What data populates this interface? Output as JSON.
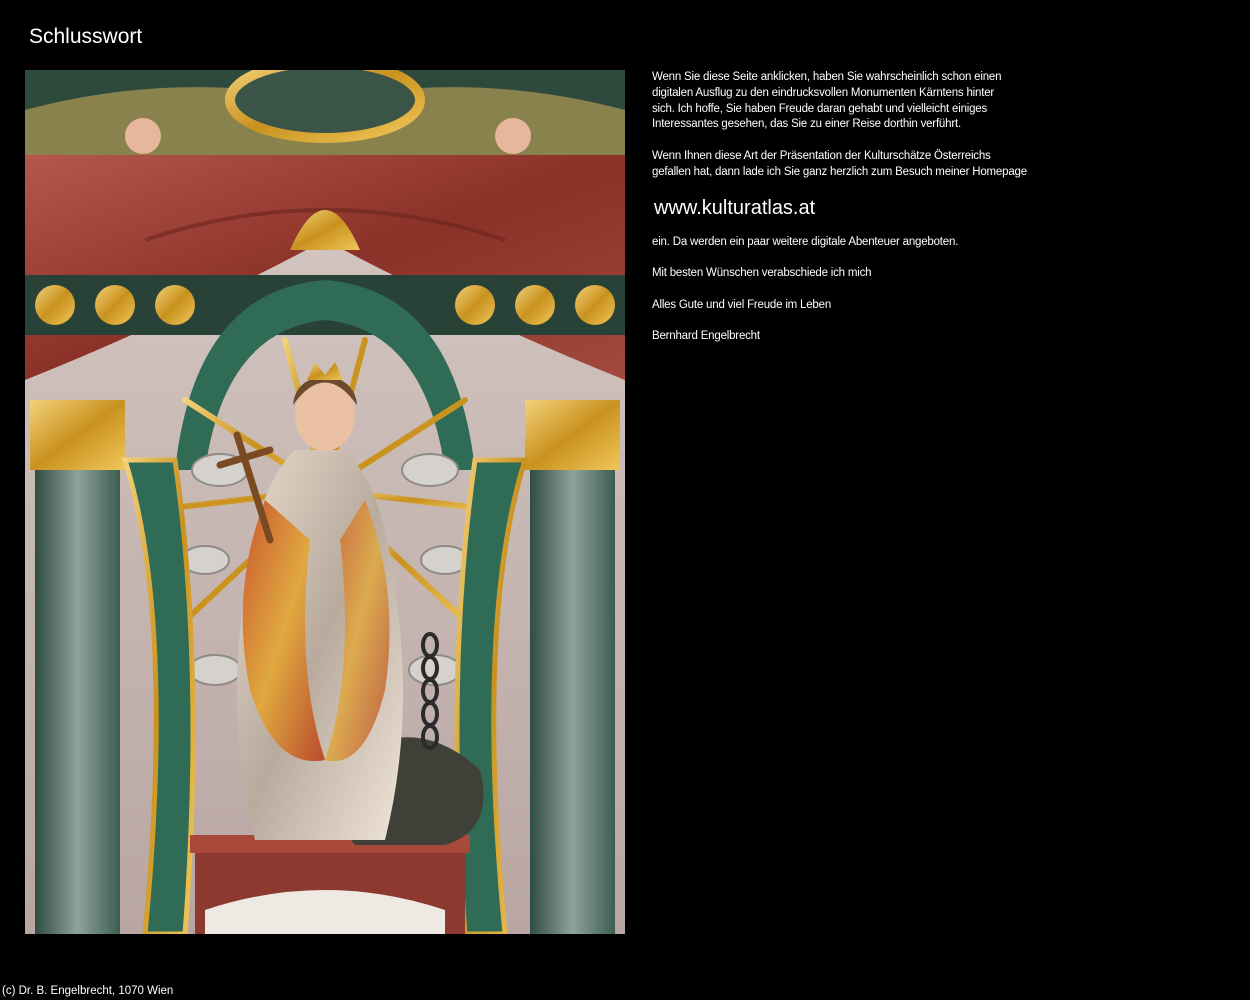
{
  "page": {
    "title": "Schlusswort"
  },
  "photo": {
    "alt": "Altarfigur mit Krone, Kreuz, Kette und Drache",
    "colors": {
      "marble_red": "#9a3f35",
      "marble_green": "#3f6b5a",
      "gold": "#d9a72c",
      "background": "#c9b7b3"
    }
  },
  "content": {
    "intro_lines": [
      "Wenn Sie diese Seite anklicken, haben Sie wahrscheinlich schon einen",
      "digitalen Ausflug zu den eindrucksvollen Monumenten Kärntens hinter",
      "sich. Ich hoffe, Sie haben Freude daran gehabt und vielleicht einiges",
      "Interessantes gesehen, das Sie zu einer Reise dorthin verführt."
    ],
    "invite_lines": [
      "Wenn Ihnen diese Art der Präsentation der Kulturschätze Österreichs",
      "gefallen hat, dann lade ich Sie ganz herzlich zum Besuch meiner Homepage"
    ],
    "homepage_link": "www.kulturatlas.at",
    "after_link": "ein. Da werden ein paar weitere digitale Abenteuer angeboten.",
    "farewell": "Mit besten Wünschen verabschiede ich mich",
    "wishes": "Alles Gute und viel Freude im Leben",
    "signature": "Bernhard Engelbrecht"
  },
  "footer": {
    "copyright": "(c) Dr. B. Engelbrecht, 1070 Wien"
  }
}
